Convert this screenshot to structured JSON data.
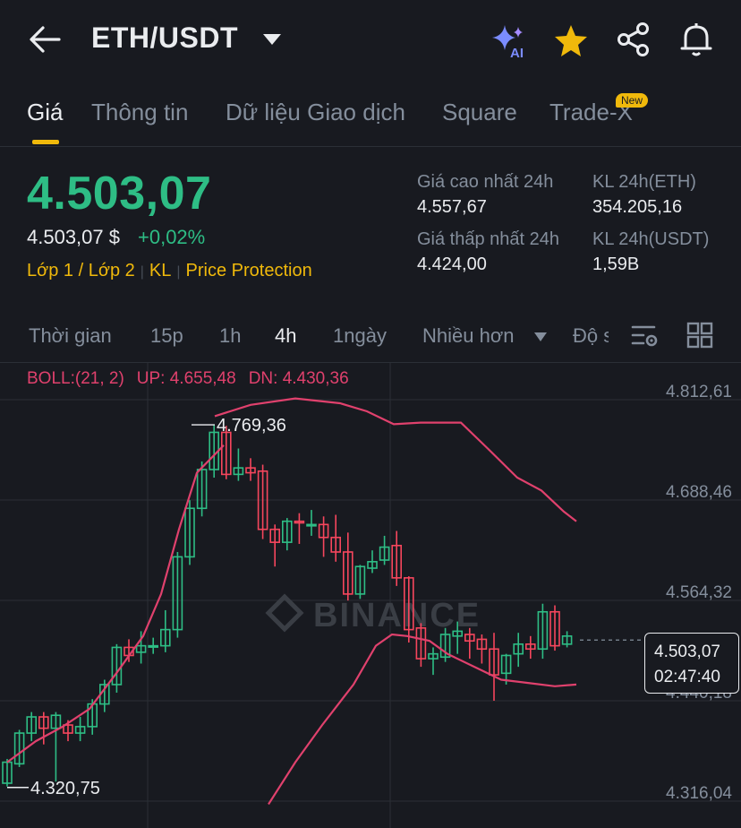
{
  "header": {
    "title": "ETH/USDT",
    "icons": [
      "back-arrow-icon",
      "caret-down-icon",
      "ai-sparkle-icon",
      "star-icon",
      "share-icon",
      "bell-icon"
    ],
    "ai_badge": "AI"
  },
  "tabs": [
    {
      "label": "Giá",
      "active": true
    },
    {
      "label": "Thông tin",
      "active": false
    },
    {
      "label": "Dữ liệu Giao dịch",
      "active": false
    },
    {
      "label": "Square",
      "active": false
    },
    {
      "label": "Trade-X",
      "active": false,
      "badge": "New"
    }
  ],
  "price": {
    "last": "4.503,07",
    "usd": "4.503,07 $",
    "change": "+0,02%",
    "layer": "Lớp 1 / Lớp 2",
    "kl": "KL",
    "protection": "Price Protection"
  },
  "stats": {
    "high_label": "Giá cao nhất 24h",
    "high_value": "4.557,67",
    "vol_eth_label": "KL 24h(ETH)",
    "vol_eth_value": "354.205,16",
    "low_label": "Giá thấp nhất 24h",
    "low_value": "4.424,00",
    "vol_usdt_label": "KL 24h(USDT)",
    "vol_usdt_value": "1,59B"
  },
  "intervals": [
    {
      "label": "Thời gian",
      "active": false
    },
    {
      "label": "15p",
      "active": false
    },
    {
      "label": "1h",
      "active": false
    },
    {
      "label": "4h",
      "active": true
    },
    {
      "label": "1ngày",
      "active": false
    },
    {
      "label": "Nhiều hơn",
      "active": false
    },
    {
      "label": "Độ s",
      "active": false
    }
  ],
  "boll": {
    "params": "BOLL:(21, 2)",
    "up": "UP: 4.655,48",
    "dn": "DN: 4.430,36"
  },
  "colors": {
    "up": "#2ebd85",
    "down": "#f6465d",
    "accent": "#f0b90b",
    "boll": "#e0416d",
    "background": "#181a20"
  },
  "watermark": "BINANCE",
  "chart_data": {
    "type": "candlestick",
    "y_ticks": [
      "4.812,61",
      "4.688,46",
      "4.564,32",
      "4.440,18",
      "4.316,04"
    ],
    "ylim": [
      4300,
      4830
    ],
    "current_price": "4.503,07",
    "countdown": "02:47:40",
    "max_label": "4.769,36",
    "min_label": "4.320,75",
    "candles": [
      [
        4326,
        4352,
        4322,
        4356
      ],
      [
        4350,
        4388,
        4346,
        4392
      ],
      [
        4388,
        4408,
        4378,
        4414
      ],
      [
        4408,
        4394,
        4374,
        4414
      ],
      [
        4394,
        4410,
        4328,
        4414
      ],
      [
        4398,
        4388,
        4378,
        4404
      ],
      [
        4388,
        4396,
        4378,
        4408
      ],
      [
        4396,
        4424,
        4386,
        4430
      ],
      [
        4424,
        4448,
        4414,
        4454
      ],
      [
        4448,
        4494,
        4438,
        4498
      ],
      [
        4494,
        4484,
        4476,
        4504
      ],
      [
        4488,
        4496,
        4474,
        4514
      ],
      [
        4496,
        4496,
        4486,
        4506
      ],
      [
        4496,
        4516,
        4488,
        4540
      ],
      [
        4516,
        4606,
        4506,
        4612
      ],
      [
        4606,
        4666,
        4596,
        4676
      ],
      [
        4666,
        4714,
        4656,
        4724
      ],
      [
        4714,
        4760,
        4704,
        4769
      ],
      [
        4760,
        4708,
        4702,
        4768
      ],
      [
        4708,
        4716,
        4700,
        4740
      ],
      [
        4716,
        4710,
        4700,
        4728
      ],
      [
        4712,
        4640,
        4628,
        4720
      ],
      [
        4640,
        4624,
        4594,
        4646
      ],
      [
        4624,
        4650,
        4614,
        4654
      ],
      [
        4650,
        4648,
        4622,
        4660
      ],
      [
        4646,
        4646,
        4632,
        4664
      ],
      [
        4646,
        4630,
        4606,
        4656
      ],
      [
        4630,
        4612,
        4600,
        4658
      ],
      [
        4612,
        4560,
        4552,
        4636
      ],
      [
        4560,
        4594,
        4554,
        4596
      ],
      [
        4592,
        4600,
        4586,
        4614
      ],
      [
        4602,
        4618,
        4596,
        4632
      ],
      [
        4620,
        4580,
        4570,
        4638
      ],
      [
        4580,
        4516,
        4500,
        4582
      ],
      [
        4518,
        4480,
        4470,
        4524
      ],
      [
        4480,
        4486,
        4460,
        4494
      ],
      [
        4482,
        4510,
        4476,
        4518
      ],
      [
        4508,
        4514,
        4486,
        4526
      ],
      [
        4510,
        4502,
        4480,
        4518
      ],
      [
        4504,
        4492,
        4474,
        4510
      ],
      [
        4492,
        4460,
        4428,
        4512
      ],
      [
        4462,
        4484,
        4448,
        4486
      ],
      [
        4486,
        4498,
        4470,
        4512
      ],
      [
        4498,
        4492,
        4480,
        4508
      ],
      [
        4492,
        4538,
        4480,
        4548
      ],
      [
        4538,
        4496,
        4490,
        4546
      ],
      [
        4498,
        4508,
        4494,
        4514
      ]
    ],
    "boll_upper": [
      [
        240,
        4780
      ],
      [
        280,
        4794
      ],
      [
        330,
        4802
      ],
      [
        380,
        4796
      ],
      [
        410,
        4786
      ],
      [
        440,
        4770
      ],
      [
        470,
        4772
      ],
      [
        515,
        4772
      ],
      [
        545,
        4740
      ],
      [
        578,
        4704
      ],
      [
        605,
        4688
      ],
      [
        630,
        4662
      ],
      [
        644,
        4650
      ]
    ],
    "boll_lower": [
      [
        300,
        4300
      ],
      [
        330,
        4352
      ],
      [
        360,
        4398
      ],
      [
        395,
        4448
      ],
      [
        420,
        4496
      ],
      [
        438,
        4510
      ],
      [
        455,
        4508
      ],
      [
        480,
        4502
      ],
      [
        500,
        4486
      ],
      [
        530,
        4470
      ],
      [
        560,
        4454
      ],
      [
        590,
        4450
      ],
      [
        620,
        4446
      ],
      [
        644,
        4448
      ]
    ],
    "boll_middle": [
      [
        8,
        4352
      ],
      [
        40,
        4378
      ],
      [
        70,
        4396
      ],
      [
        100,
        4418
      ],
      [
        130,
        4462
      ],
      [
        160,
        4508
      ],
      [
        180,
        4560
      ],
      [
        200,
        4640
      ],
      [
        220,
        4710
      ],
      [
        250,
        4744
      ]
    ]
  }
}
